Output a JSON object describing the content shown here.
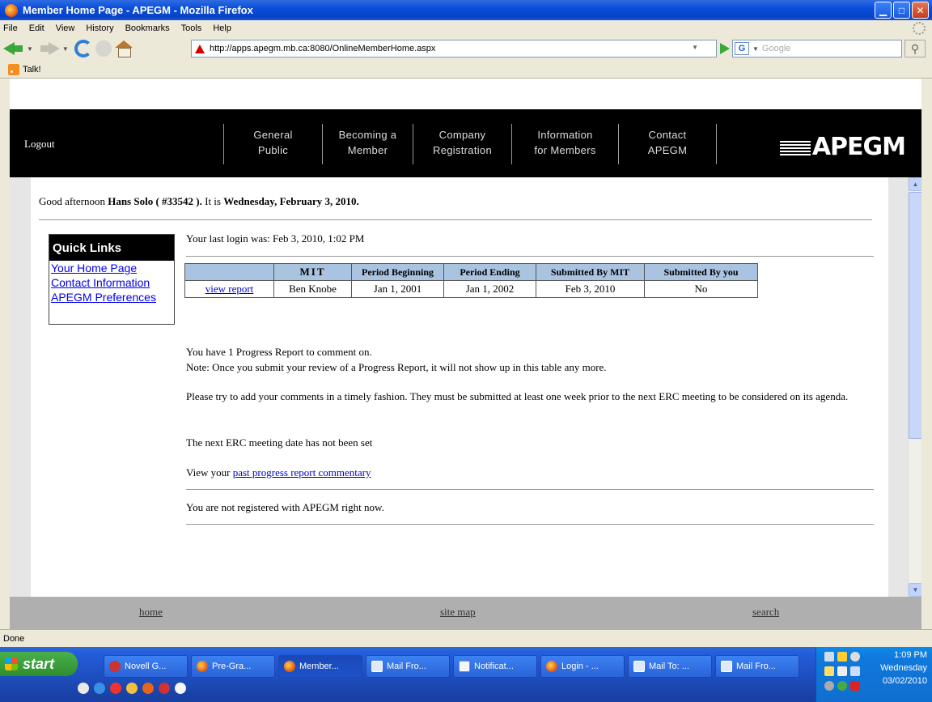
{
  "window": {
    "title": "Member Home Page - APEGM - Mozilla Firefox",
    "controls": [
      "minimize",
      "maximize",
      "close"
    ]
  },
  "menu": [
    "File",
    "Edit",
    "View",
    "History",
    "Bookmarks",
    "Tools",
    "Help"
  ],
  "navigation": {
    "url": "http://apps.apegm.mb.ca:8080/OnlineMemberHome.aspx",
    "search_placeholder": "Google",
    "search_engine_icon": "G"
  },
  "bookmarks": [
    "Talk!"
  ],
  "site_header": {
    "logout": "Logout",
    "nav": [
      {
        "line1": "General",
        "line2": "Public"
      },
      {
        "line1": "Becoming a",
        "line2": "Member"
      },
      {
        "line1": "Company",
        "line2": "Registration"
      },
      {
        "line1": "Information",
        "line2": "for Members"
      },
      {
        "line1": "Contact",
        "line2": "APEGM"
      }
    ],
    "logo": "APEGM"
  },
  "greeting": {
    "prefix": "Good afternoon",
    "name": "Hans Solo ( #33542 ).",
    "mid": "It is",
    "date": "Wednesday, February 3, 2010."
  },
  "quick_links": {
    "title": "Quick Links",
    "items": [
      "Your Home Page",
      "Contact Information",
      "APEGM Preferences"
    ]
  },
  "last_login": "Your last login was: Feb 3, 2010, 1:02 PM",
  "report_table": {
    "headers": [
      "",
      "MIT",
      "Period Beginning",
      "Period Ending",
      "Submitted By MIT",
      "Submitted By you"
    ],
    "rows": [
      [
        "view report",
        "Ben Knobe",
        "Jan 1, 2001",
        "Jan 1, 2002",
        "Feb 3, 2010",
        "No"
      ]
    ]
  },
  "paragraphs": {
    "progress_count": "You have 1 Progress Report to comment on.",
    "note": "Note: Once you submit your review of a Progress Report, it will not show up in this table any more.",
    "timely": "Please try to add your comments in a timely fashion. They must be submitted at least one week prior to the next ERC meeting to be considered on its agenda.",
    "erc_date": "The next ERC meeting date has not been set",
    "view_your": "View your",
    "past_link": "past progress report commentary",
    "not_registered": "You are not registered with APEGM right now."
  },
  "footer": {
    "home": "home",
    "sitemap": "site map",
    "search": "search"
  },
  "status": "Done",
  "taskbar": {
    "start": "start",
    "tasks": [
      "Novell G...",
      "Pre-Gra...",
      "Member...",
      "Mail Fro...",
      "Notificat...",
      "Login - ...",
      "Mail To: ...",
      "Mail Fro..."
    ],
    "active_index": 2,
    "clock_time": "1:09 PM",
    "clock_day": "Wednesday",
    "clock_date": "03/02/2010"
  }
}
